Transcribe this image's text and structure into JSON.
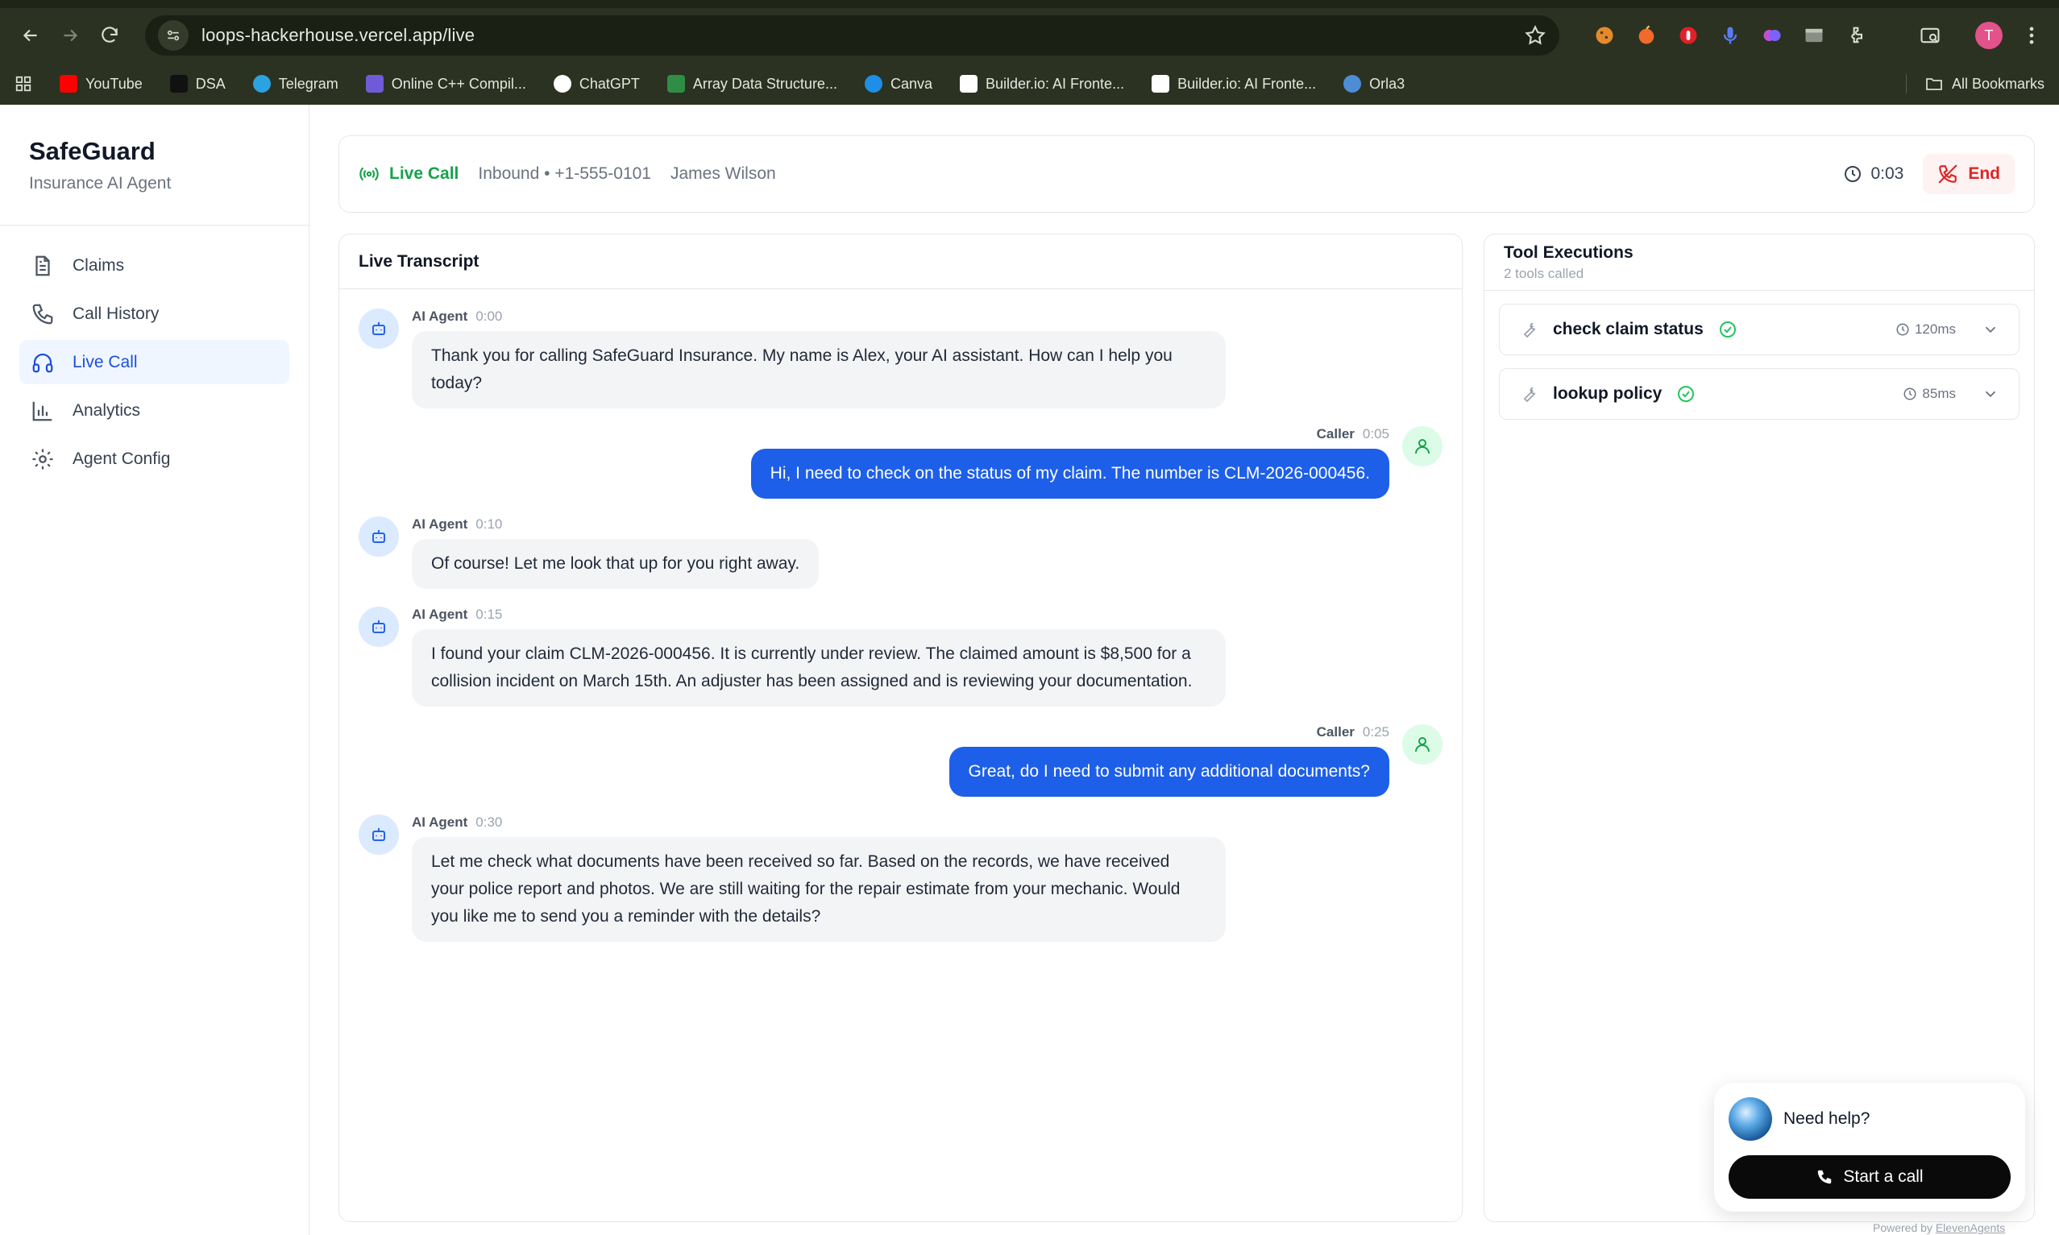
{
  "browser": {
    "url": "loops-hackerhouse.vercel.app/live",
    "profile_initial": "T",
    "bookmarks": [
      {
        "label": "YouTube",
        "color": "#ff0000"
      },
      {
        "label": "DSA",
        "color": "#111111"
      },
      {
        "label": "Telegram",
        "color": "#2aa3e0"
      },
      {
        "label": "Online C++ Compil...",
        "color": "#6f5bd8"
      },
      {
        "label": "ChatGPT",
        "color": "#ffffff"
      },
      {
        "label": "Array Data Structure...",
        "color": "#2f8d46"
      },
      {
        "label": "Canva",
        "color": "#1f8ee6"
      },
      {
        "label": "Builder.io: AI Fronte...",
        "color": "#ffffff"
      },
      {
        "label": "Builder.io: AI Fronte...",
        "color": "#ffffff"
      },
      {
        "label": "Orla3",
        "color": "#4c8dd6"
      }
    ],
    "all_bookmarks": "All Bookmarks"
  },
  "sidebar": {
    "brand": "SafeGuard",
    "subtitle": "Insurance AI Agent",
    "items": [
      {
        "label": "Claims",
        "icon": "file-text-icon"
      },
      {
        "label": "Call History",
        "icon": "phone-icon"
      },
      {
        "label": "Live Call",
        "icon": "headphones-icon",
        "active": true
      },
      {
        "label": "Analytics",
        "icon": "bar-chart-icon"
      },
      {
        "label": "Agent Config",
        "icon": "gear-icon"
      }
    ]
  },
  "callbar": {
    "status": "Live Call",
    "direction_number": "Inbound • +1-555-0101",
    "caller_name": "James Wilson",
    "timer": "0:03",
    "end_label": "End"
  },
  "transcript": {
    "title": "Live Transcript",
    "messages": [
      {
        "role": "agent",
        "who": "AI Agent",
        "time": "0:00",
        "text": "Thank you for calling SafeGuard Insurance. My name is Alex, your AI assistant. How can I help you today?"
      },
      {
        "role": "caller",
        "who": "Caller",
        "time": "0:05",
        "text": "Hi, I need to check on the status of my claim. The number is CLM-2026-000456."
      },
      {
        "role": "agent",
        "who": "AI Agent",
        "time": "0:10",
        "text": "Of course! Let me look that up for you right away."
      },
      {
        "role": "agent",
        "who": "AI Agent",
        "time": "0:15",
        "text": "I found your claim CLM-2026-000456. It is currently under review. The claimed amount is $8,500 for a collision incident on March 15th. An adjuster has been assigned and is reviewing your documentation."
      },
      {
        "role": "caller",
        "who": "Caller",
        "time": "0:25",
        "text": "Great, do I need to submit any additional documents?"
      },
      {
        "role": "agent",
        "who": "AI Agent",
        "time": "0:30",
        "text": "Let me check what documents have been received so far. Based on the records, we have received your police report and photos. We are still waiting for the repair estimate from your mechanic. Would you like me to send you a reminder with the details?"
      }
    ]
  },
  "tools": {
    "title": "Tool Executions",
    "subtitle": "2 tools called",
    "items": [
      {
        "name": "check claim status",
        "duration": "120ms"
      },
      {
        "name": "lookup policy",
        "duration": "85ms"
      }
    ]
  },
  "help_widget": {
    "prompt": "Need help?",
    "button": "Start a call",
    "powered_prefix": "Powered by",
    "powered_brand": "ElevenAgents"
  }
}
